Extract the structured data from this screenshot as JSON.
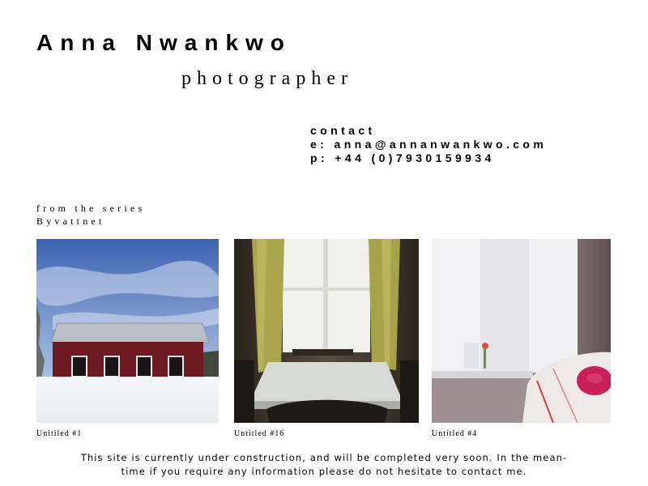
{
  "header": {
    "name": "Anna Nwankwo",
    "role": "photographer"
  },
  "contact": {
    "heading": "contact",
    "email_line": "e: anna@annanwankwo.com",
    "phone_line": "p: +44 (0)7930159934"
  },
  "series": {
    "intro": "from the series",
    "title": "Byvattnet"
  },
  "gallery": [
    {
      "caption": "Unitiled #1",
      "image": "red-barn-in-snow-photo"
    },
    {
      "caption": "Untitled #16",
      "image": "table-by-window-photo"
    },
    {
      "caption": "Untitled #4",
      "image": "lace-curtain-window-photo"
    }
  ],
  "footer": {
    "line1": "This site is currently under construction, and will be completed very soon. In the mean-",
    "line2": "time if you require any information please do not hesitate to contact me."
  },
  "colors": {
    "background": "#ffffff",
    "text": "#000000"
  }
}
